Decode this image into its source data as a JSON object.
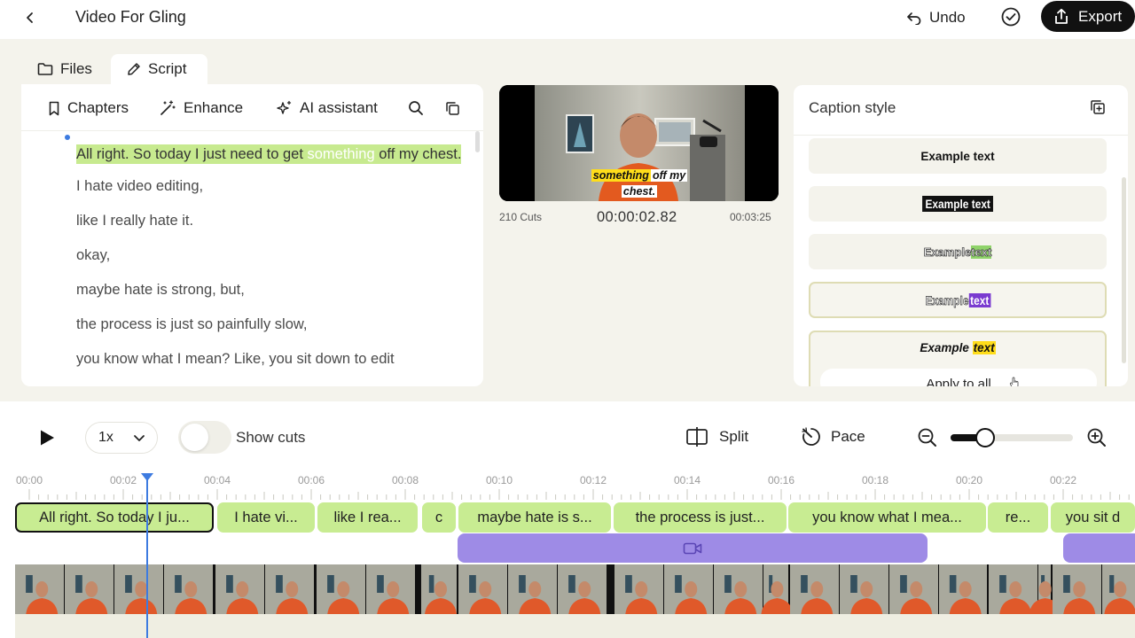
{
  "header": {
    "title": "Video For Gling",
    "undo_label": "Undo",
    "export_label": "Export"
  },
  "tabs": [
    {
      "label": "Files",
      "icon": "folder-icon"
    },
    {
      "label": "Script",
      "icon": "pencil-icon",
      "active": true
    }
  ],
  "script_toolbar": {
    "chapters_label": "Chapters",
    "enhance_label": "Enhance",
    "ai_label": "AI assistant"
  },
  "script": {
    "first_line": {
      "before": "All right. So today I just need to get ",
      "highlight": "something",
      "after": " off my chest."
    },
    "lines": [
      "I hate video editing,",
      "like I really hate it.",
      "okay,",
      "maybe hate is strong, but,",
      "the process is just so painfully slow,",
      "you know what I mean? Like, you sit down to edit"
    ]
  },
  "video": {
    "caption_plain_1": "something",
    "caption_plain_2": "off my",
    "caption_plain_3": "chest.",
    "cuts": "210 Cuts",
    "timecode": "00:00:02.82",
    "duration": "00:03:25"
  },
  "caption_style": {
    "title": "Caption style",
    "items": [
      {
        "text": "Example text"
      },
      {
        "text": "Example text"
      },
      {
        "text_a": "Example",
        "text_b": "text"
      },
      {
        "text_a": "Example",
        "text_b": "text"
      },
      {
        "text_a": "Example",
        "text_b": "text"
      }
    ],
    "apply_label": "Apply to all"
  },
  "timeline": {
    "speed": "1x",
    "show_cuts_label": "Show cuts",
    "show_cuts_on": false,
    "split_label": "Split",
    "pace_label": "Pace",
    "zoom_level": 0.2,
    "ruler_labels": [
      "00:00",
      "00:02",
      "00:04",
      "00:06",
      "00:08",
      "00:10",
      "00:12",
      "00:14",
      "00:16",
      "00:18",
      "00:20",
      "00:22"
    ],
    "clips": [
      {
        "label": "All right. So today I ju...",
        "selected": true
      },
      {
        "label": "I hate vi..."
      },
      {
        "label": "like I rea..."
      },
      {
        "label": "c"
      },
      {
        "label": "maybe hate is s..."
      },
      {
        "label": "the process is just..."
      },
      {
        "label": "you know what I mea..."
      },
      {
        "label": "re..."
      },
      {
        "label": "you sit d"
      }
    ]
  },
  "colors": {
    "highlight_green": "#c7ea8f",
    "broll_purple": "#9e8be6",
    "playhead_blue": "#3d7be0",
    "caption_yellow": "#ffdd1a"
  }
}
